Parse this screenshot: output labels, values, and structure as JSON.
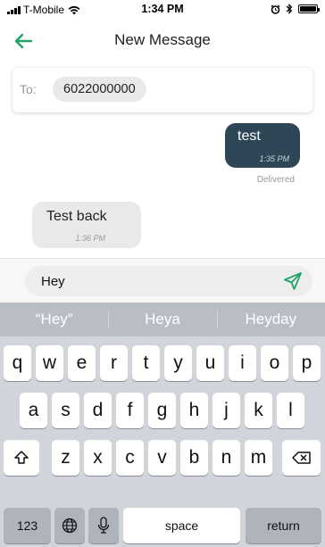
{
  "status_bar": {
    "carrier": "T-Mobile",
    "time": "1:34 PM"
  },
  "header": {
    "title": "New Message",
    "back_icon": "arrow-left-icon",
    "accent_color": "#21a366"
  },
  "recipient": {
    "label": "To:",
    "number": "6022000000"
  },
  "messages": {
    "outgoing": {
      "text": "test",
      "time": "1:35 PM",
      "status": "Delivered"
    },
    "incoming": {
      "text": "Test back",
      "time": "1:36 PM"
    }
  },
  "composer": {
    "value": "Hey",
    "send_icon": "send-icon",
    "send_color": "#21a366"
  },
  "keyboard": {
    "suggestions": [
      "“Hey”",
      "Heya",
      "Heyday"
    ],
    "row1": [
      "q",
      "w",
      "e",
      "r",
      "t",
      "y",
      "u",
      "i",
      "o",
      "p"
    ],
    "row2": [
      "a",
      "s",
      "d",
      "f",
      "g",
      "h",
      "j",
      "k",
      "l"
    ],
    "row3": [
      "z",
      "x",
      "c",
      "v",
      "b",
      "n",
      "m"
    ],
    "numbers_label": "123",
    "space_label": "space",
    "return_label": "return"
  }
}
